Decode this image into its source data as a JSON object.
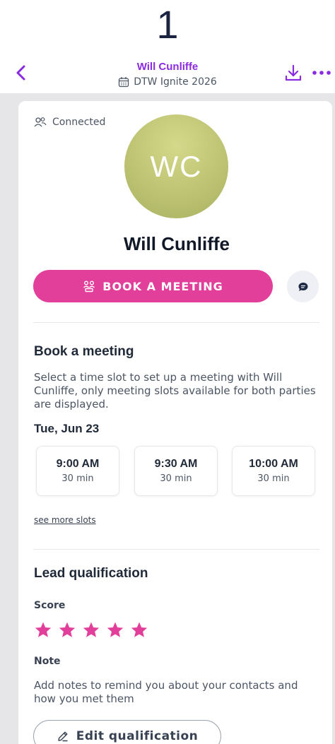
{
  "step_number": "1",
  "header": {
    "title": "Will Cunliffe",
    "subtitle": "DTW Ignite 2026",
    "accent_color": "#8a2be2"
  },
  "profile": {
    "status": "Connected",
    "initials": "WC",
    "name": "Will Cunliffe",
    "avatar_color": "#b8bf6c"
  },
  "actions": {
    "book_label": "BOOK A MEETING",
    "book_color": "#e23f9a"
  },
  "book_meeting": {
    "title": "Book a meeting",
    "description": "Select a time slot to set up a meeting with Will Cunliffe, only meeting slots available for both parties are displayed.",
    "date": "Tue, Jun 23",
    "slots": [
      {
        "time": "9:00 AM",
        "duration": "30 min"
      },
      {
        "time": "9:30 AM",
        "duration": "30 min"
      },
      {
        "time": "10:00 AM",
        "duration": "30 min"
      }
    ],
    "see_more": "see more slots"
  },
  "lead": {
    "title": "Lead qualification",
    "score_label": "Score",
    "score": 5,
    "score_max": 5,
    "note_label": "Note",
    "note_text": "Add notes to remind you about your contacts and how you met them",
    "edit_label": "Edit qualification"
  }
}
